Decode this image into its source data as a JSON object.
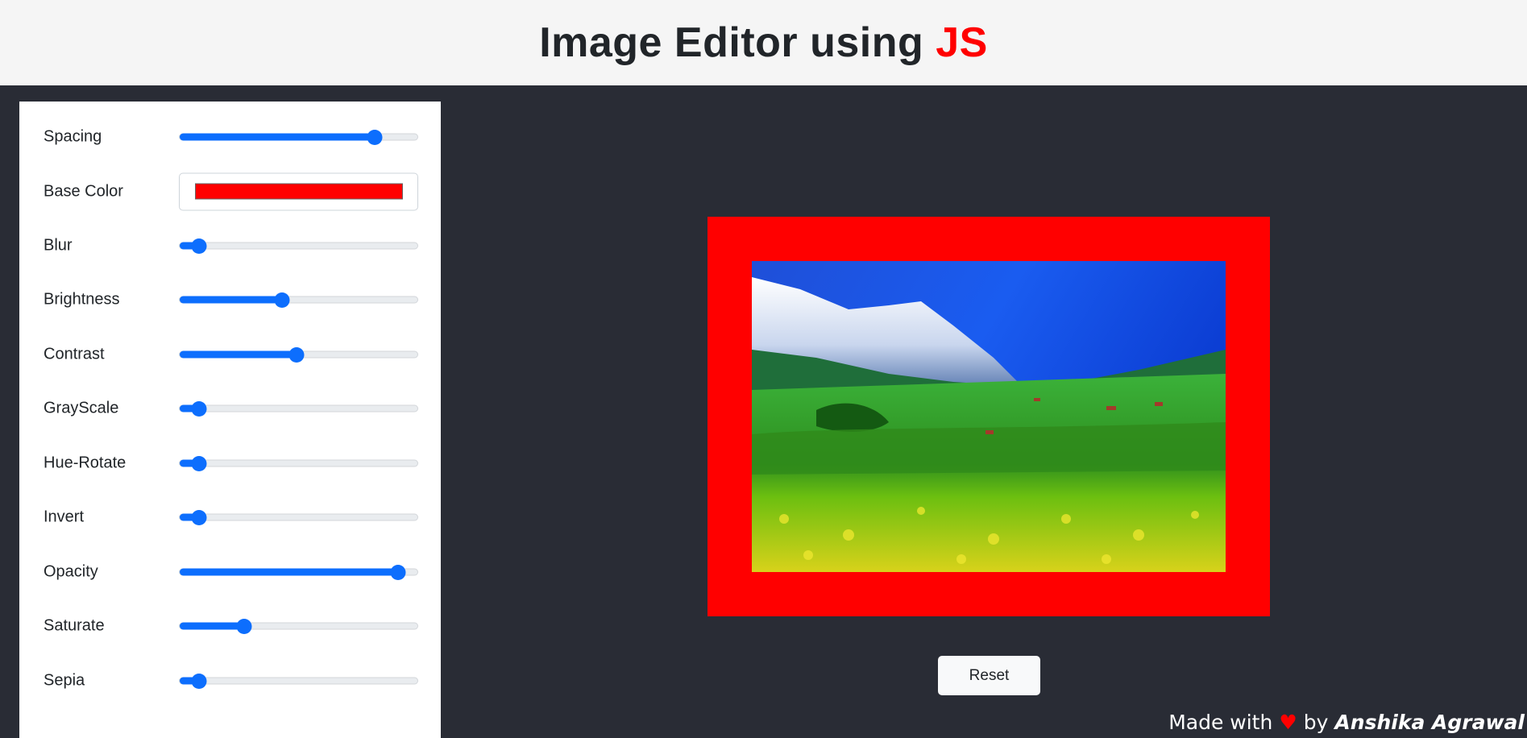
{
  "header": {
    "title_main": "Image Editor using ",
    "title_accent": "JS",
    "accent_color": "#ff0000"
  },
  "controls": [
    {
      "label": "Spacing",
      "type": "range",
      "fraction": 0.82
    },
    {
      "label": "Base Color",
      "type": "color",
      "value": "#ff0000"
    },
    {
      "label": "Blur",
      "type": "range",
      "fraction": 0.08
    },
    {
      "label": "Brightness",
      "type": "range",
      "fraction": 0.43
    },
    {
      "label": "Contrast",
      "type": "range",
      "fraction": 0.49
    },
    {
      "label": "GrayScale",
      "type": "range",
      "fraction": 0.08
    },
    {
      "label": "Hue-Rotate",
      "type": "range",
      "fraction": 0.08
    },
    {
      "label": "Invert",
      "type": "range",
      "fraction": 0.08
    },
    {
      "label": "Opacity",
      "type": "range",
      "fraction": 0.92
    },
    {
      "label": "Saturate",
      "type": "range",
      "fraction": 0.27
    },
    {
      "label": "Sepia",
      "type": "range",
      "fraction": 0.08
    }
  ],
  "preview": {
    "frame_color": "#ff0000",
    "image_description_icon": "landscape-photo"
  },
  "reset_label": "Reset",
  "footer": {
    "made_with": "Made with",
    "heart": "♥",
    "by": "by",
    "author": "Anshika Agrawal"
  },
  "colors": {
    "slider_accent": "#0d6efd",
    "background": "#292c35",
    "header_bg": "#f5f5f5"
  }
}
